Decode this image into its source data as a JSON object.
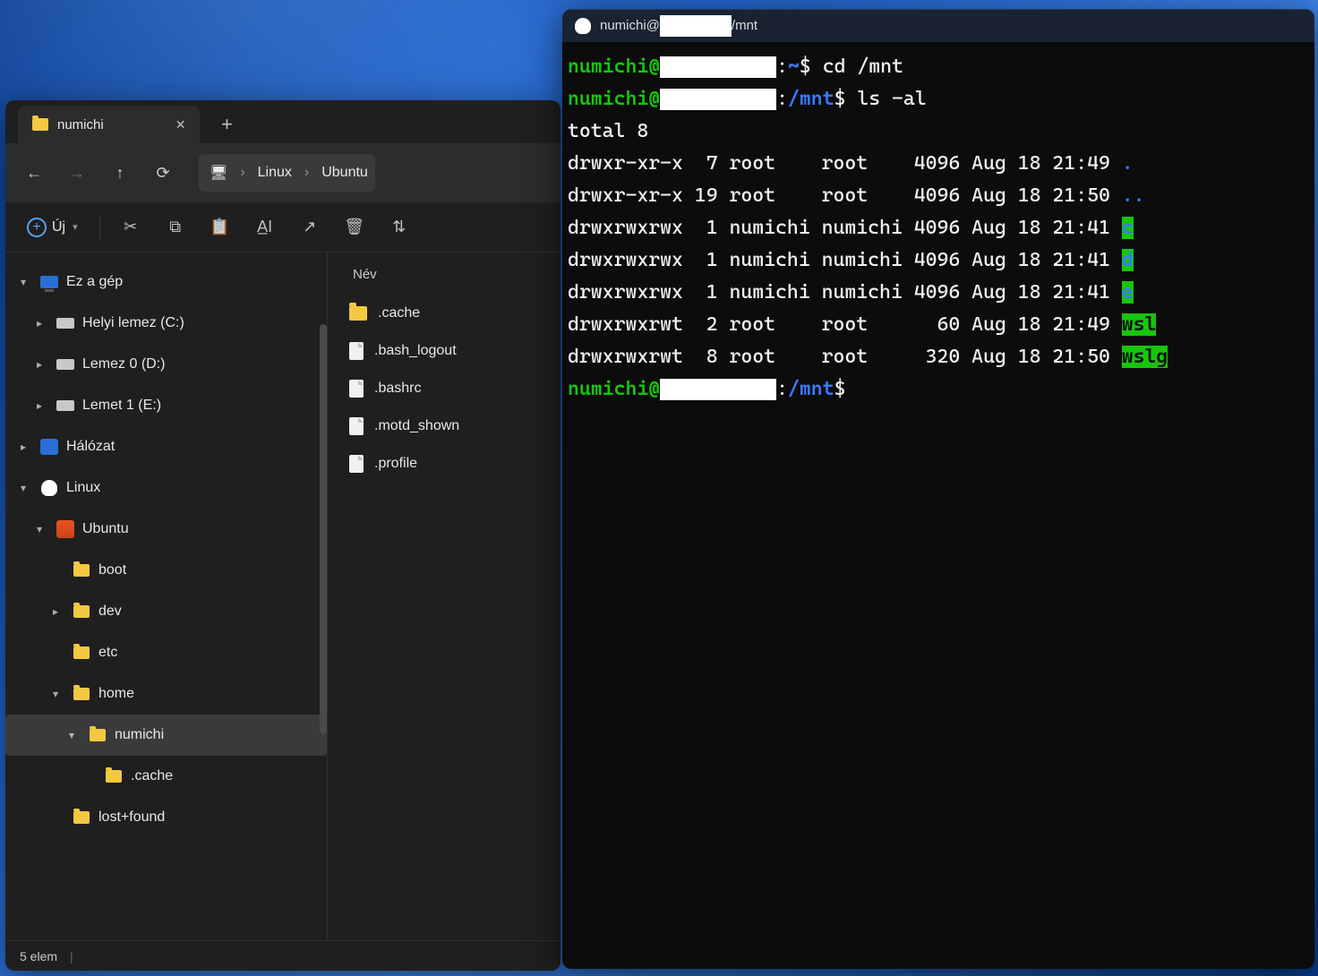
{
  "explorer": {
    "tab_title": "numichi",
    "toolbar": {
      "new_label": "Új"
    },
    "breadcrumb": {
      "root_icon": "monitor",
      "items": [
        "Linux",
        "Ubuntu"
      ]
    },
    "sidebar": [
      {
        "indent": 0,
        "chev": "down",
        "icon": "pc",
        "label": "Ez a gép"
      },
      {
        "indent": 1,
        "chev": "right",
        "icon": "drive",
        "label": "Helyi lemez (C:)"
      },
      {
        "indent": 1,
        "chev": "right",
        "icon": "drive",
        "label": "Lemez 0 (D:)"
      },
      {
        "indent": 1,
        "chev": "right",
        "icon": "drive",
        "label": "Lemet 1 (E:)"
      },
      {
        "indent": 0,
        "chev": "right",
        "icon": "net",
        "label": "Hálózat"
      },
      {
        "indent": 0,
        "chev": "down",
        "icon": "tux",
        "label": "Linux"
      },
      {
        "indent": 1,
        "chev": "down",
        "icon": "ubu",
        "label": "Ubuntu"
      },
      {
        "indent": 2,
        "chev": "",
        "icon": "folder",
        "label": "boot"
      },
      {
        "indent": 2,
        "chev": "right",
        "icon": "folder",
        "label": "dev"
      },
      {
        "indent": 2,
        "chev": "",
        "icon": "folder",
        "label": "etc"
      },
      {
        "indent": 2,
        "chev": "down",
        "icon": "folder",
        "label": "home"
      },
      {
        "indent": 3,
        "chev": "down",
        "icon": "folder",
        "label": "numichi",
        "selected": true
      },
      {
        "indent": 4,
        "chev": "",
        "icon": "folder",
        "label": ".cache"
      },
      {
        "indent": 2,
        "chev": "",
        "icon": "folder",
        "label": "lost+found"
      }
    ],
    "content": {
      "column": "Név",
      "items": [
        {
          "icon": "folder",
          "name": ".cache"
        },
        {
          "icon": "file",
          "name": ".bash_logout"
        },
        {
          "icon": "file",
          "name": ".bashrc"
        },
        {
          "icon": "file",
          "name": ".motd_shown"
        },
        {
          "icon": "file",
          "name": ".profile"
        }
      ]
    },
    "status": "5 elem"
  },
  "terminal": {
    "title_prefix": "numichi@",
    "title_suffix": "/mnt",
    "prompt_user": "numichi@",
    "lines": [
      {
        "path": "~",
        "cmd": "cd /mnt"
      },
      {
        "path": "/mnt",
        "cmd": "ls -al"
      }
    ],
    "total": "total 8",
    "listing": [
      {
        "perm": "drwxr-xr-x",
        "n": " 7",
        "own": "root   ",
        "grp": "root   ",
        "size": "4096",
        "date": "Aug 18 21:49",
        "name": ".",
        "cls": "b"
      },
      {
        "perm": "drwxr-xr-x",
        "n": "19",
        "own": "root   ",
        "grp": "root   ",
        "size": "4096",
        "date": "Aug 18 21:50",
        "name": "..",
        "cls": "b"
      },
      {
        "perm": "drwxrwxrwx",
        "n": " 1",
        "own": "numichi",
        "grp": "numichi",
        "size": "4096",
        "date": "Aug 18 21:41",
        "name": "c",
        "cls": "hl"
      },
      {
        "perm": "drwxrwxrwx",
        "n": " 1",
        "own": "numichi",
        "grp": "numichi",
        "size": "4096",
        "date": "Aug 18 21:41",
        "name": "d",
        "cls": "hl"
      },
      {
        "perm": "drwxrwxrwx",
        "n": " 1",
        "own": "numichi",
        "grp": "numichi",
        "size": "4096",
        "date": "Aug 18 21:41",
        "name": "e",
        "cls": "hl"
      },
      {
        "perm": "drwxrwxrwt",
        "n": " 2",
        "own": "root   ",
        "grp": "root   ",
        "size": "  60",
        "date": "Aug 18 21:49",
        "name": "wsl",
        "cls": "hl2"
      },
      {
        "perm": "drwxrwxrwt",
        "n": " 8",
        "own": "root   ",
        "grp": "root   ",
        "size": " 320",
        "date": "Aug 18 21:50",
        "name": "wslg",
        "cls": "hl2"
      }
    ],
    "final_path": "/mnt"
  }
}
